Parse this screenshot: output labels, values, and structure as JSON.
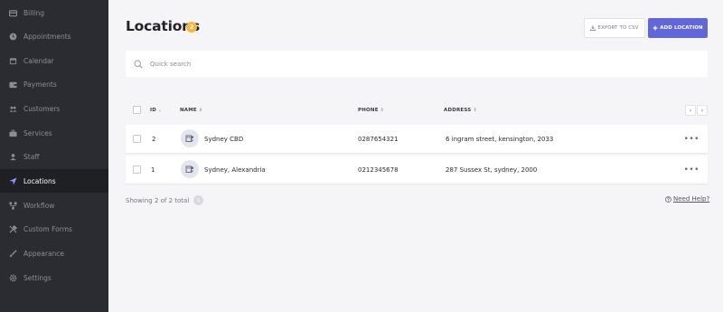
{
  "sidebar": {
    "items": [
      {
        "label": "Billing",
        "icon": "card-icon"
      },
      {
        "label": "Appointments",
        "icon": "clock-icon"
      },
      {
        "label": "Calendar",
        "icon": "calendar-icon"
      },
      {
        "label": "Payments",
        "icon": "wallet-icon"
      },
      {
        "label": "Customers",
        "icon": "users-icon"
      },
      {
        "label": "Services",
        "icon": "briefcase-icon"
      },
      {
        "label": "Staff",
        "icon": "user-icon"
      },
      {
        "label": "Locations",
        "icon": "location-arrow-icon"
      },
      {
        "label": "Workflow",
        "icon": "workflow-icon"
      },
      {
        "label": "Custom Forms",
        "icon": "tools-icon"
      },
      {
        "label": "Appearance",
        "icon": "brush-icon"
      },
      {
        "label": "Settings",
        "icon": "gear-icon"
      }
    ],
    "active": "Locations"
  },
  "header": {
    "title": "Locations",
    "count": "2",
    "export_label": "EXPORT TO CSV",
    "add_label": "ADD LOCATION"
  },
  "search": {
    "placeholder": "Quick search",
    "value": ""
  },
  "table": {
    "columns": {
      "id": "ID",
      "name": "NAME",
      "phone": "PHONE",
      "address": "ADDRESS"
    },
    "rows": [
      {
        "id": "2",
        "name": "Sydney CBD",
        "phone": "0287654321",
        "address": "6 ingram street, kensington, 2033"
      },
      {
        "id": "1",
        "name": "Sydney, Alexandria",
        "phone": "0212345678",
        "address": "287 Sussex St, sydney, 2000"
      }
    ]
  },
  "footer": {
    "showing": "Showing 2 of 2 total",
    "page": "1",
    "help": "Need Help?"
  },
  "colors": {
    "sidebar_bg": "#2b2c31",
    "accent": "#6166d8",
    "badge": "#f5b83d"
  }
}
